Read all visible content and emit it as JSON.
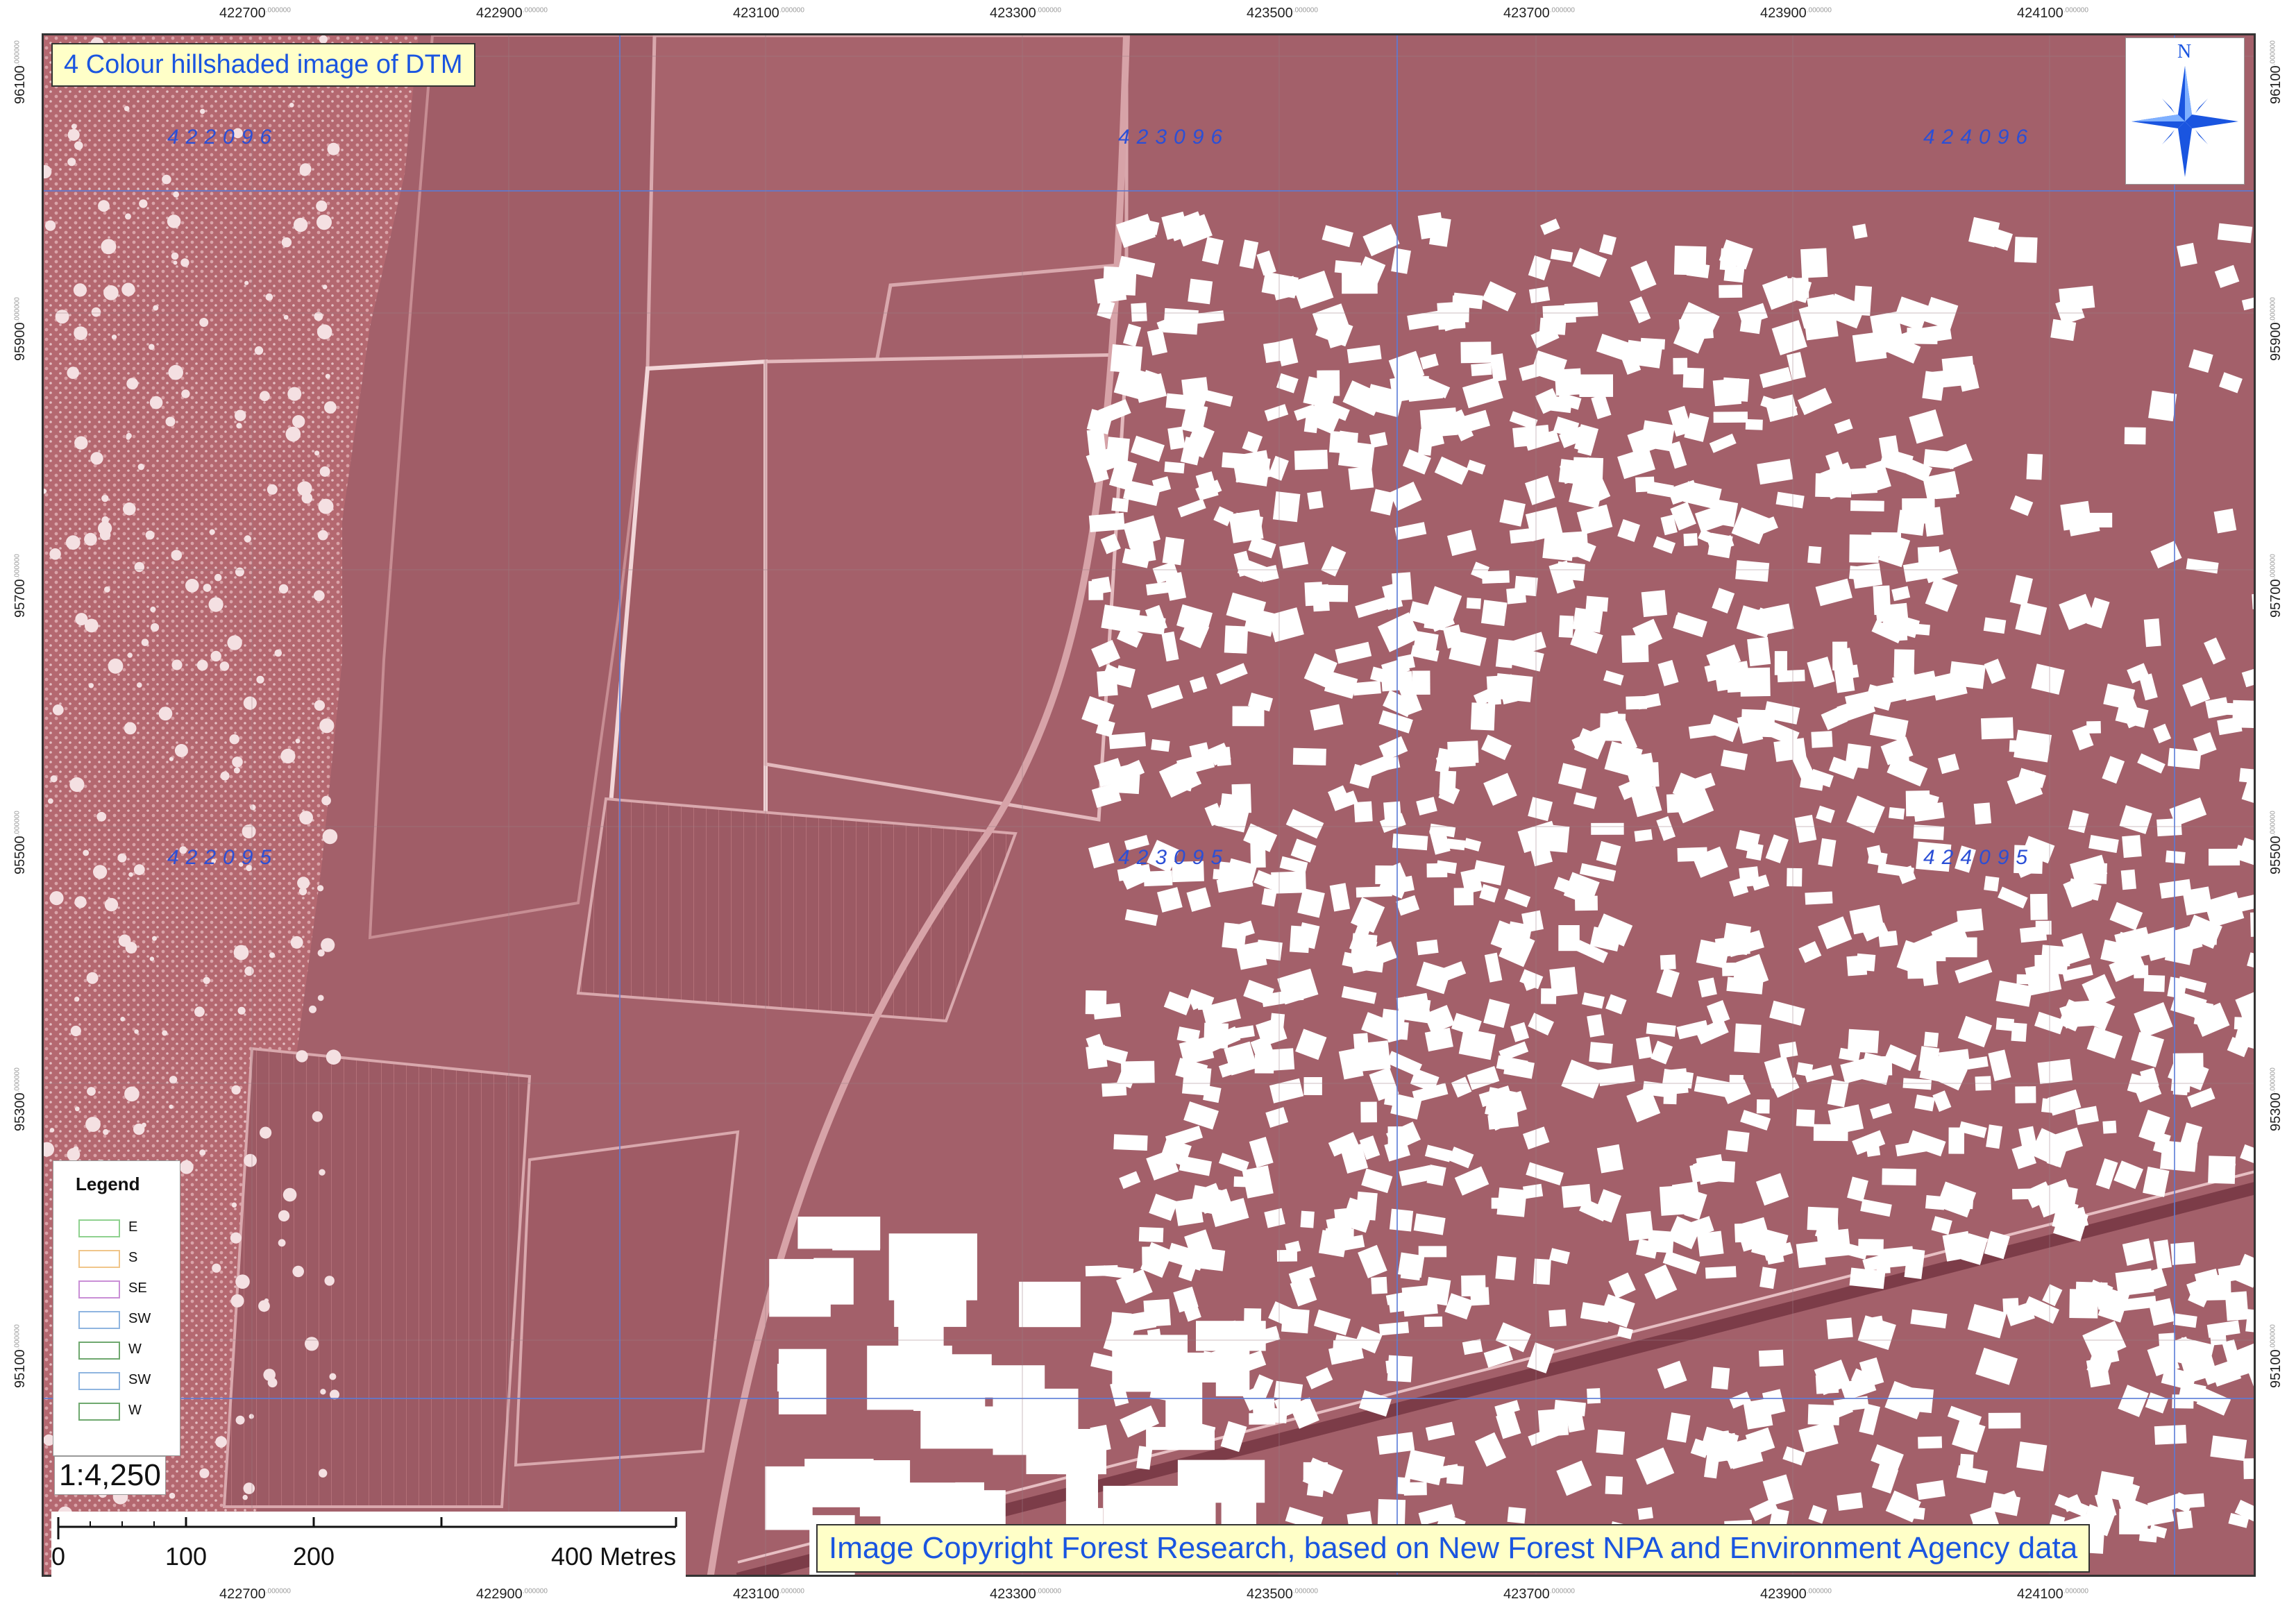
{
  "title": "4 Colour hillshaded image of DTM",
  "copyright": "Image Copyright Forest Research, based on New Forest NPA and Environment Agency data",
  "scale_ratio": "1:4,250",
  "scale_bar": {
    "labels": [
      "0",
      "100",
      "200",
      "400 Metres"
    ]
  },
  "north_arrow": {
    "label": "N"
  },
  "legend": {
    "title": "Legend",
    "items": [
      {
        "label": "E",
        "color": "#8fd18f"
      },
      {
        "label": "S",
        "color": "#f0c58a"
      },
      {
        "label": "SE",
        "color": "#c98fd6"
      },
      {
        "label": "SW",
        "color": "#8fb5e0"
      },
      {
        "label": "W",
        "color": "#6fa86f"
      },
      {
        "label": "SW",
        "color": "#8fb5e0"
      },
      {
        "label": "W",
        "color": "#6fa86f"
      }
    ]
  },
  "grid": {
    "x_ticks": [
      {
        "label": "422700",
        "sup": ".000000"
      },
      {
        "label": "422900",
        "sup": ".000000"
      },
      {
        "label": "423100",
        "sup": ".000000"
      },
      {
        "label": "423300",
        "sup": ".000000"
      },
      {
        "label": "423500",
        "sup": ".000000"
      },
      {
        "label": "423700",
        "sup": ".000000"
      },
      {
        "label": "423900",
        "sup": ".000000"
      },
      {
        "label": "424100",
        "sup": ".000000"
      }
    ],
    "y_ticks": [
      {
        "label": "96100",
        "sup": ".000000"
      },
      {
        "label": "95900",
        "sup": ".000000"
      },
      {
        "label": "95700",
        "sup": ".000000"
      },
      {
        "label": "95500",
        "sup": ".000000"
      },
      {
        "label": "95300",
        "sup": ".000000"
      },
      {
        "label": "95100",
        "sup": ".000000"
      }
    ]
  },
  "tiles": [
    "422096",
    "423096",
    "424096",
    "422095",
    "423095",
    "424095"
  ],
  "colors": {
    "map_base": "#a5616a",
    "grid_line": "#5a7bd8",
    "tile_label": "#2b4fd6",
    "title_text": "#1a55e0",
    "title_bg": "#ffffc8",
    "buildings": "#ffffff"
  }
}
